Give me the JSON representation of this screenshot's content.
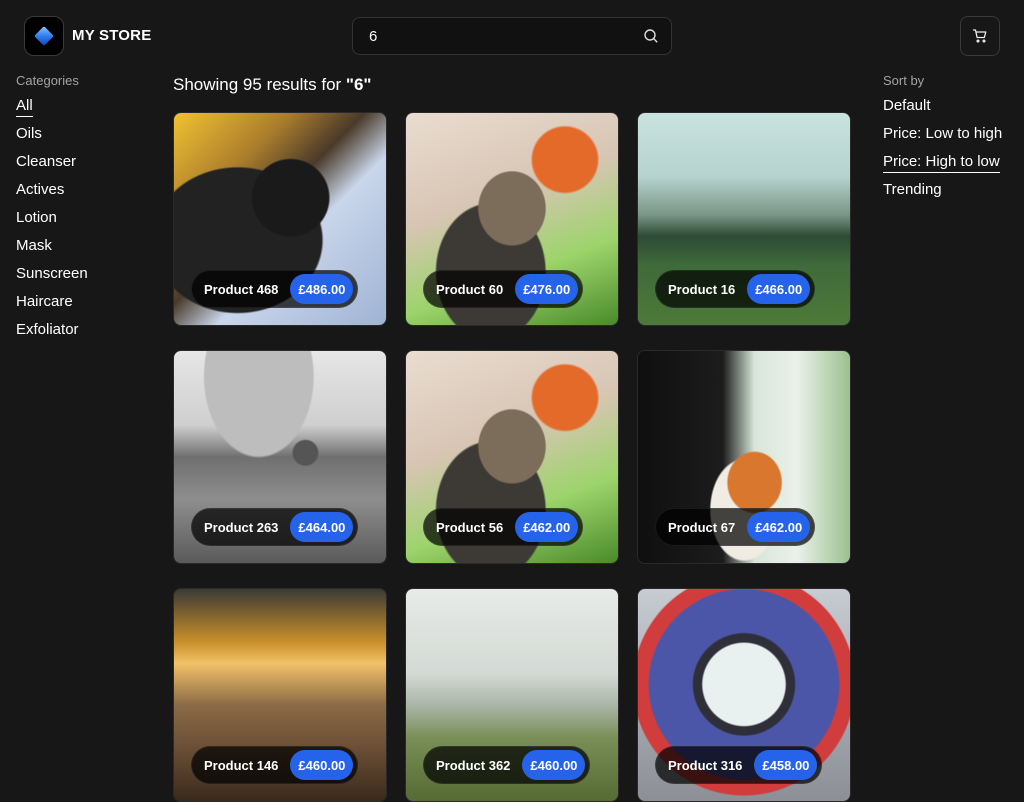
{
  "header": {
    "brand": "MY STORE",
    "search_value": "6",
    "search_placeholder": ""
  },
  "categories": {
    "heading": "Categories",
    "items": [
      {
        "label": "All",
        "active": true
      },
      {
        "label": "Oils",
        "active": false
      },
      {
        "label": "Cleanser",
        "active": false
      },
      {
        "label": "Actives",
        "active": false
      },
      {
        "label": "Lotion",
        "active": false
      },
      {
        "label": "Mask",
        "active": false
      },
      {
        "label": "Sunscreen",
        "active": false
      },
      {
        "label": "Haircare",
        "active": false
      },
      {
        "label": "Exfoliator",
        "active": false
      }
    ]
  },
  "results": {
    "prefix": "Showing 95 results for ",
    "query": "\"6\""
  },
  "sort": {
    "heading": "Sort by",
    "items": [
      {
        "label": "Default",
        "active": false
      },
      {
        "label": "Price: Low to high",
        "active": false
      },
      {
        "label": "Price: High to low",
        "active": true
      },
      {
        "label": "Trending",
        "active": false
      }
    ]
  },
  "products": [
    {
      "name": "Product 468",
      "price": "£486.00",
      "image": "img-cat-black"
    },
    {
      "name": "Product 60",
      "price": "£476.00",
      "image": "img-cat-tabby"
    },
    {
      "name": "Product 16",
      "price": "£466.00",
      "image": "img-lake"
    },
    {
      "name": "Product 263",
      "price": "£464.00",
      "image": "img-bw"
    },
    {
      "name": "Product 56",
      "price": "£462.00",
      "image": "img-cat-tabby"
    },
    {
      "name": "Product 67",
      "price": "£462.00",
      "image": "img-cat-orange"
    },
    {
      "name": "Product 146",
      "price": "£460.00",
      "image": "img-desert"
    },
    {
      "name": "Product 362",
      "price": "£460.00",
      "image": "img-fog"
    },
    {
      "name": "Product 316",
      "price": "£458.00",
      "image": "img-tunnel"
    }
  ],
  "colors": {
    "background": "#171717",
    "accent": "#2563eb",
    "muted_text": "#a3a3a3"
  }
}
